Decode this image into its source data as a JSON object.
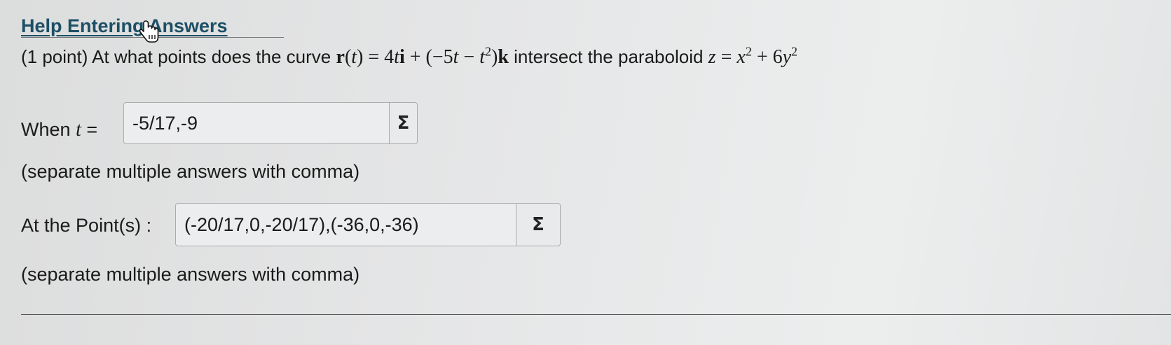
{
  "help": {
    "link_label": "Help Entering Answers"
  },
  "question": {
    "prefix": "(1 point) At what points does the curve",
    "middle": "intersect the paraboloid"
  },
  "part_t": {
    "label_prefix": "When",
    "label_var": "t",
    "label_suffix": "=",
    "value": "-5/17,-9",
    "sigma_label": "Σ",
    "instructions": "(separate multiple answers with comma)"
  },
  "part_points": {
    "label": "At the Point(s) :",
    "value": "(-20/17,0,-20/17),(-36,0,-36)",
    "sigma_label": "Σ",
    "instructions": "(separate multiple answers with comma)"
  },
  "icons": {
    "cursor": "hand-pointer-icon",
    "equation_editor": "sigma-icon"
  }
}
